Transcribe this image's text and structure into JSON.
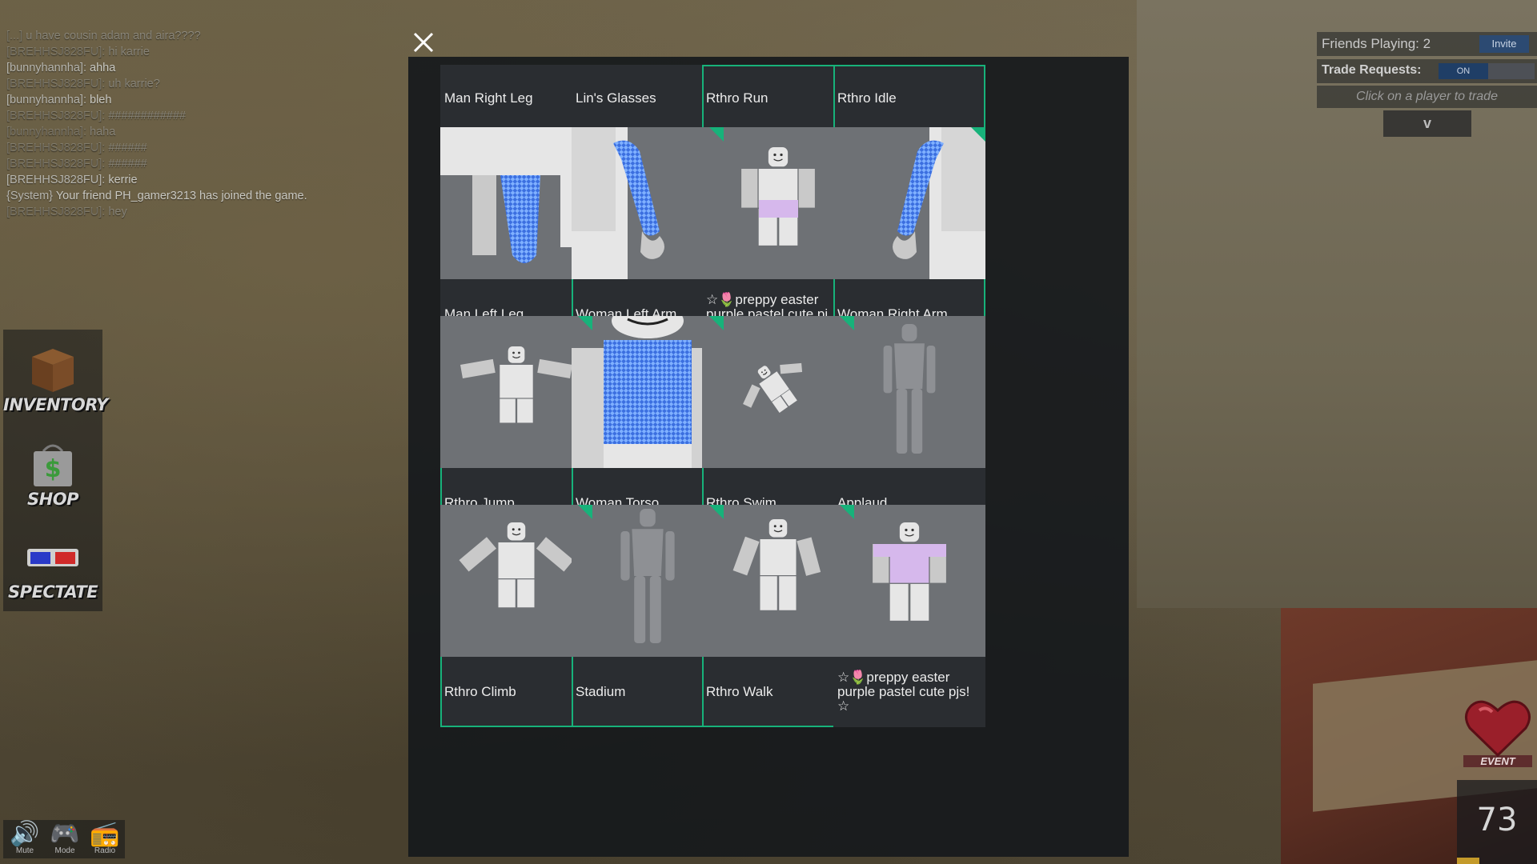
{
  "chat": {
    "lines": [
      {
        "user": "[...]",
        "msg": "u have cousin adam and aira????",
        "faded": true
      },
      {
        "user": "[BREHHSJ828FU]:",
        "msg": "hi karrie",
        "faded": true
      },
      {
        "user": "[bunnyhannha]:",
        "msg": "ahha",
        "faded": false
      },
      {
        "user": "[BREHHSJ828FU]:",
        "msg": "uh karrie?",
        "faded": true
      },
      {
        "user": "[bunnyhannha]:",
        "msg": "bleh",
        "faded": false
      },
      {
        "user": "[BREHHSJ828FU]:",
        "msg": "############",
        "faded": true
      },
      {
        "user": "[bunnyhannha]:",
        "msg": "haha",
        "faded": true
      },
      {
        "user": "[BREHHSJ828FU]:",
        "msg": "######",
        "faded": true
      },
      {
        "user": "[BREHHSJ828FU]:",
        "msg": "######",
        "faded": true
      },
      {
        "user": "[BREHHSJ828FU]:",
        "msg": "kerrie",
        "faded": false
      },
      {
        "user": "{System}",
        "msg": "Your friend PH_gamer3213 has joined the game.",
        "faded": false
      },
      {
        "user": "[BREHHSJ828FU]:",
        "msg": "hey",
        "faded": true
      }
    ]
  },
  "sidebar": {
    "inventory_label": "INVENTORY",
    "shop_label": "SHOP",
    "spectate_label": "SPECTATE"
  },
  "controls": {
    "mute_label": "Mute",
    "mode_label": "Mode",
    "radio_label": "Radio"
  },
  "hud": {
    "friends_playing": "Friends Playing: 2",
    "invite_label": "Invite",
    "trade_label": "Trade Requests:",
    "trade_toggle": "ON",
    "trade_hint": "Click on a player to trade",
    "collapse_label": "v",
    "event_label": "EVENT",
    "timer": "73"
  },
  "colors": {
    "equipped": "#17b27a",
    "panel": "#16191c",
    "card": "#2a2d31",
    "thumb": "#6e7175"
  },
  "inventory": {
    "items": [
      {
        "name": "Man Right Leg",
        "equipped": false,
        "thumb": "leg-right"
      },
      {
        "name": "Lin's Glasses",
        "equipped": false,
        "thumb": "glasses"
      },
      {
        "name": "Rthro Run",
        "equipped": true,
        "thumb": "run"
      },
      {
        "name": "Rthro Idle",
        "equipped": true,
        "thumb": "idle"
      },
      {
        "name": "Man Left Leg",
        "equipped": false,
        "thumb": "leg-left"
      },
      {
        "name": "Woman Left Arm",
        "equipped": true,
        "thumb": "arm-left"
      },
      {
        "name": "☆🌷preppy easter purple pastel cute pj pants!☆",
        "equipped": false,
        "thumb": "pj-pants"
      },
      {
        "name": "Woman Right Arm",
        "equipped": true,
        "thumb": "arm-right"
      },
      {
        "name": "Rthro Jump",
        "equipped": true,
        "thumb": "jump"
      },
      {
        "name": "Woman Torso",
        "equipped": true,
        "thumb": "torso"
      },
      {
        "name": "Rthro Swim",
        "equipped": true,
        "thumb": "swim"
      },
      {
        "name": "Applaud",
        "equipped": false,
        "thumb": "applaud"
      },
      {
        "name": "Rthro Climb",
        "equipped": true,
        "thumb": "climb"
      },
      {
        "name": "Stadium",
        "equipped": true,
        "thumb": "stadium"
      },
      {
        "name": "Rthro Walk",
        "equipped": true,
        "thumb": "walk"
      },
      {
        "name": "☆🌷preppy easter purple pastel cute pjs!☆",
        "equipped": false,
        "thumb": "pjs"
      }
    ]
  }
}
